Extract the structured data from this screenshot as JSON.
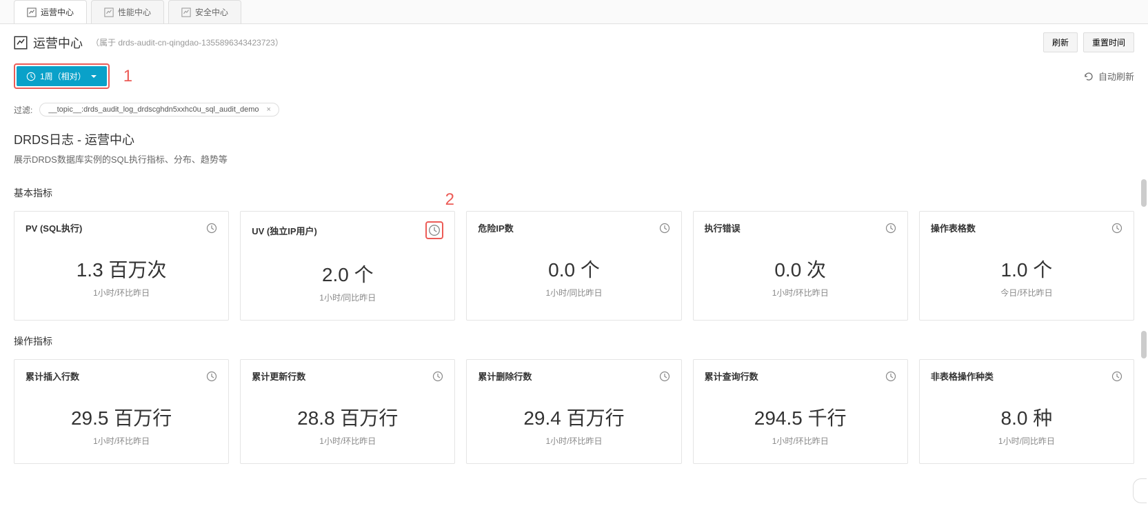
{
  "tabs": [
    {
      "label": "运营中心",
      "active": true
    },
    {
      "label": "性能中心",
      "active": false
    },
    {
      "label": "安全中心",
      "active": false
    }
  ],
  "header": {
    "title": "运营中心",
    "subtitle": "（属于 drds-audit-cn-qingdao-1355896343423723）",
    "refresh_btn": "刷新",
    "reset_time_btn": "重置时间"
  },
  "toolbar": {
    "time_label": "1周（相对）",
    "annotation1": "1",
    "auto_refresh": "自动刷新"
  },
  "filter": {
    "label": "过滤:",
    "chip_text": "__topic__:drds_audit_log_drdscghdn5xxhc0u_sql_audit_demo",
    "chip_close": "×"
  },
  "dashboard": {
    "title": "DRDS日志 - 运营中心",
    "desc": "展示DRDS数据库实例的SQL执行指标、分布、趋势等"
  },
  "sections": {
    "basic": "基本指标",
    "ops": "操作指标",
    "annotation2": "2"
  },
  "basic_metrics": [
    {
      "title": "PV (SQL执行)",
      "value": "1.3 百万次",
      "sub": "1小时/环比昨日",
      "hl": false
    },
    {
      "title": "UV (独立IP用户)",
      "value": "2.0 个",
      "sub": "1小时/同比昨日",
      "hl": true
    },
    {
      "title": "危险IP数",
      "value": "0.0 个",
      "sub": "1小时/同比昨日",
      "hl": false
    },
    {
      "title": "执行错误",
      "value": "0.0 次",
      "sub": "1小时/环比昨日",
      "hl": false
    },
    {
      "title": "操作表格数",
      "value": "1.0 个",
      "sub": "今日/环比昨日",
      "hl": false
    }
  ],
  "ops_metrics": [
    {
      "title": "累计插入行数",
      "value": "29.5 百万行",
      "sub": "1小时/环比昨日"
    },
    {
      "title": "累计更新行数",
      "value": "28.8 百万行",
      "sub": "1小时/环比昨日"
    },
    {
      "title": "累计删除行数",
      "value": "29.4 百万行",
      "sub": "1小时/环比昨日"
    },
    {
      "title": "累计查询行数",
      "value": "294.5 千行",
      "sub": "1小时/环比昨日"
    },
    {
      "title": "非表格操作种类",
      "value": "8.0 种",
      "sub": "1小时/同比昨日"
    }
  ]
}
